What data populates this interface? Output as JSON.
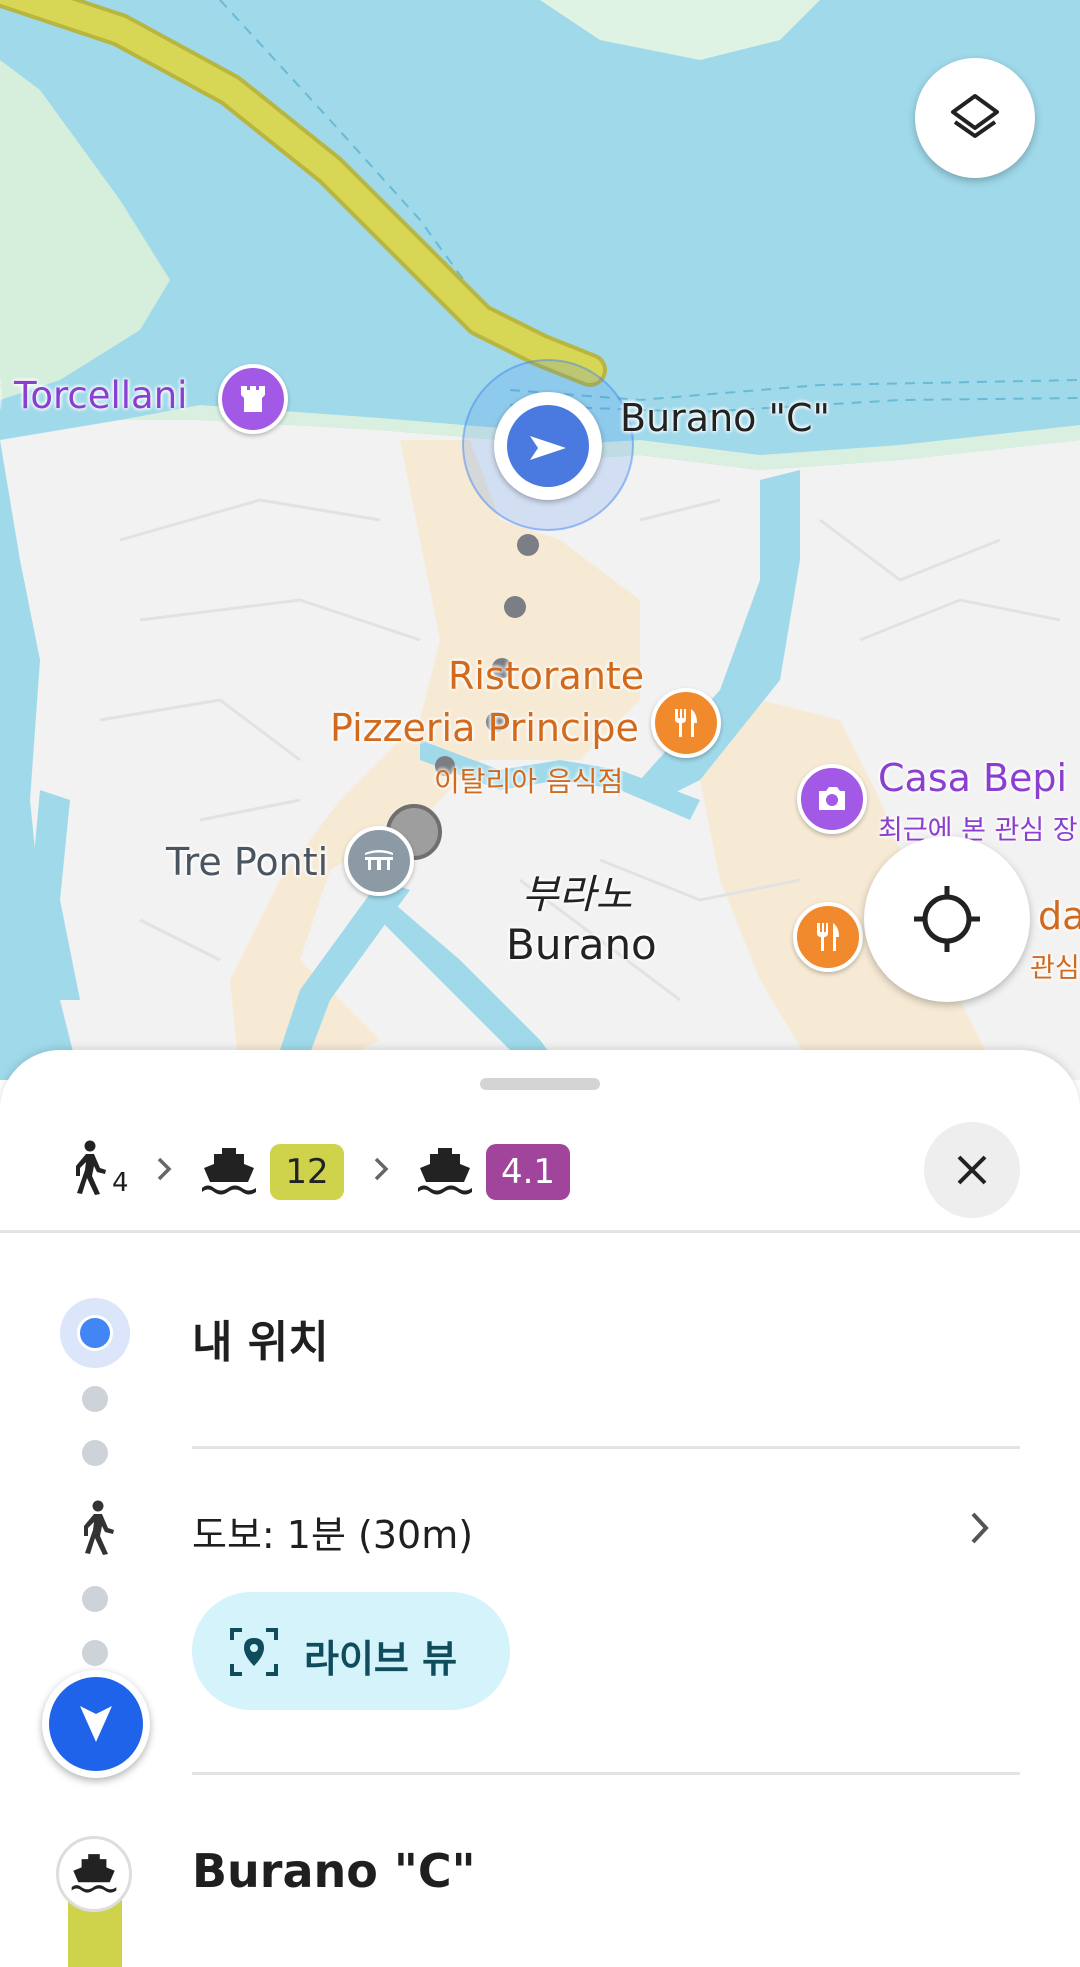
{
  "map": {
    "labels": {
      "torcellani": "i Torcellani",
      "stop_label": "Burano \"C\"",
      "restaurant_line1": "Ristorante",
      "restaurant_line2": "Pizzeria Principe",
      "restaurant_category": "이탈리아 음식점",
      "casa_bepi": "Casa Bepi",
      "casa_bepi_sub": "최근에 본 관심 장",
      "tre_ponti": "Tre Ponti",
      "town_korean": "부라노",
      "town": "Burano",
      "da_fragment": "da",
      "da_sub_fragment": "관심 장"
    },
    "icons": {
      "layers": "layers-icon",
      "recenter": "my-location-icon",
      "navigation": "navigation-arrow-icon"
    }
  },
  "route_summary": {
    "walk_minutes": "4",
    "ferry_line_1": "12",
    "ferry_line_2": "4.1",
    "ferry_line_1_color": "#cfd34c",
    "ferry_line_2_color": "#a0449c",
    "close": "close-icon"
  },
  "steps": {
    "origin": "내 위치",
    "walk": "도보: 1분 (30m)",
    "live_view": "라이브 뷰",
    "stop": "Burano \"C\""
  },
  "colors": {
    "accent": "#4285f4",
    "water": "#9fd9ea",
    "route_yellow": "#d8d655"
  }
}
